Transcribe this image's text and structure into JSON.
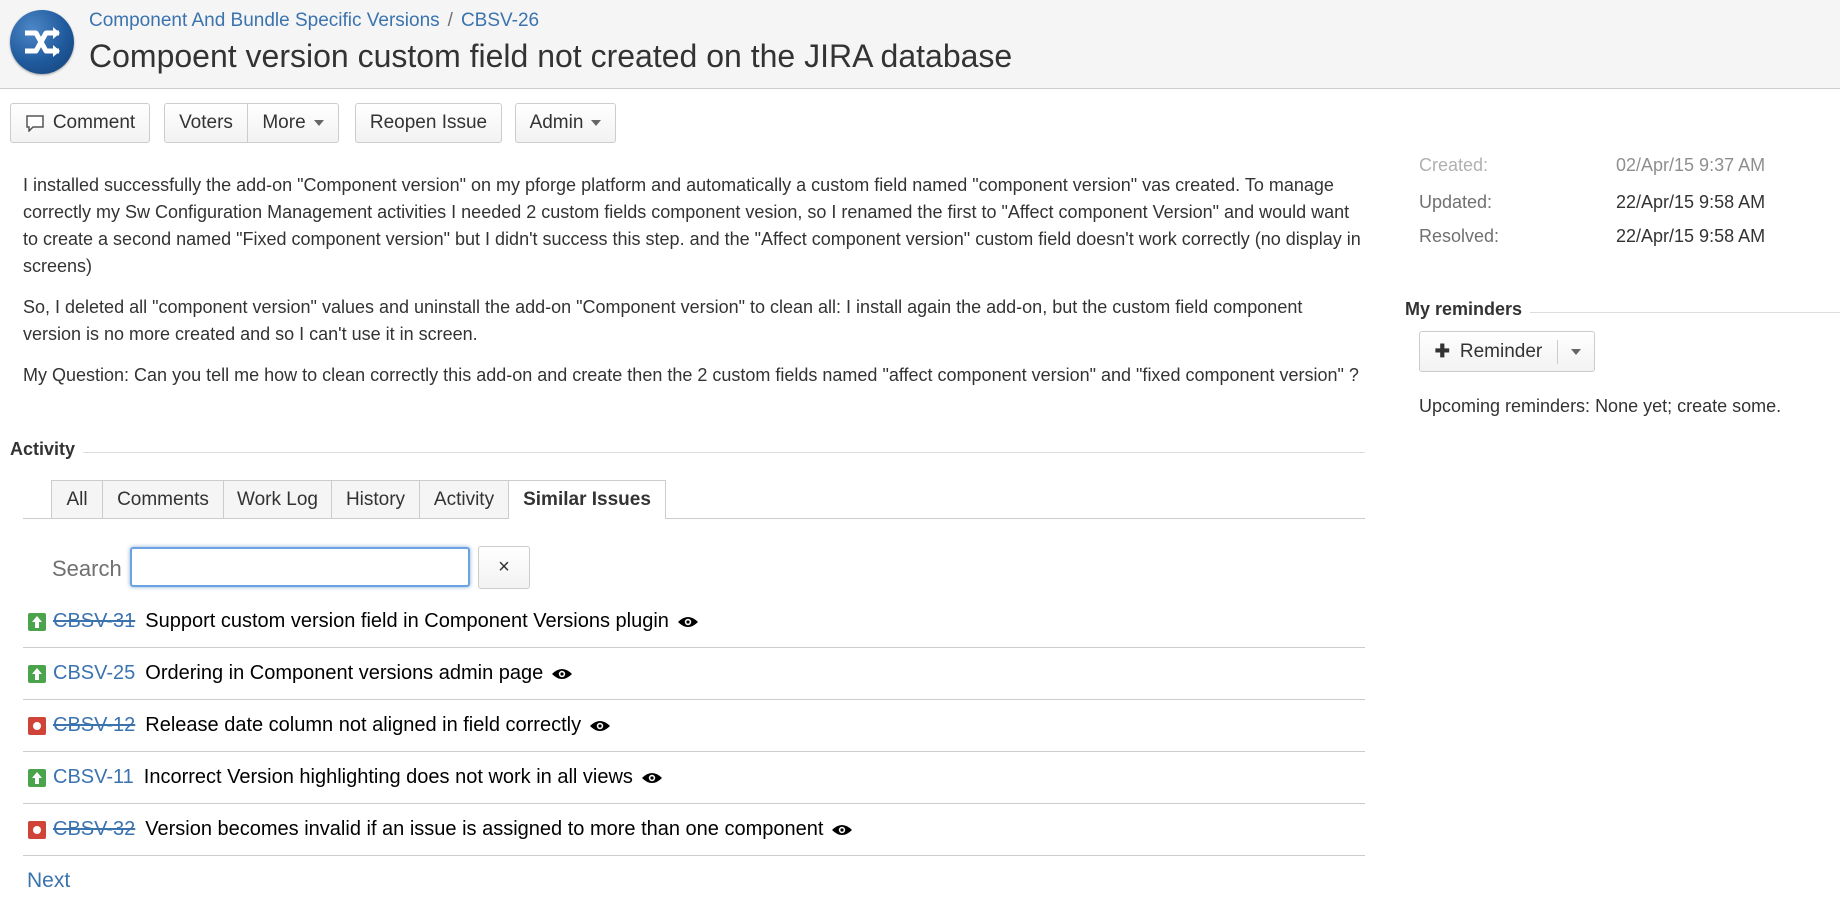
{
  "header": {
    "breadcrumb_project": "Component And Bundle Specific Versions",
    "breadcrumb_separator": "/",
    "breadcrumb_issue": "CBSV-26",
    "title": "Compoent version custom field not created on the JIRA database"
  },
  "toolbar": {
    "comment": "Comment",
    "voters": "Voters",
    "more": "More",
    "reopen": "Reopen Issue",
    "admin": "Admin"
  },
  "description": {
    "p1": "I installed successfully the add-on \"Component version\" on my pforge platform and automatically a custom field named \"component version\" vas created. To manage correctly my Sw Configuration Management activities I needed 2 custom fields component vesion, so I renamed the first to \"Affect component Version\" and would want to create a second named \"Fixed component version\" but I didn't success this step. and the \"Affect component version\" custom field doesn't work correctly (no display in screens)",
    "p2": "So, I deleted all \"component version\" values and uninstall the add-on \"Component version\" to clean all: I install again the add-on, but the custom field component version is no more created and so I can't use it in screen.",
    "p3": "My Question: Can you tell me how to clean correctly this add-on and create then the 2 custom fields named \"affect component version\" and \"fixed component version\" ?"
  },
  "activity": {
    "heading": "Activity",
    "tabs": [
      "All",
      "Comments",
      "Work Log",
      "History",
      "Activity",
      "Similar Issues"
    ],
    "active_tab": "Similar Issues",
    "search_label": "Search",
    "search_value": "",
    "clear_label": "×",
    "issues": [
      {
        "key": "CBSV-31",
        "summary": "Support custom version field in Component Versions plugin",
        "type": "improvement",
        "resolved": true
      },
      {
        "key": "CBSV-25",
        "summary": "Ordering in Component versions admin page",
        "type": "improvement",
        "resolved": false
      },
      {
        "key": "CBSV-12",
        "summary": "Release date column not aligned in field correctly",
        "type": "bug",
        "resolved": true
      },
      {
        "key": "CBSV-11",
        "summary": "Incorrect Version highlighting does not work in all views",
        "type": "improvement",
        "resolved": false
      },
      {
        "key": "CBSV-32",
        "summary": "Version becomes invalid if an issue is assigned to more than one component",
        "type": "bug",
        "resolved": true
      }
    ],
    "next": "Next"
  },
  "dates": {
    "created_label": "Created:",
    "created_value": "02/Apr/15 9:37 AM",
    "updated_label": "Updated:",
    "updated_value": "22/Apr/15 9:58 AM",
    "resolved_label": "Resolved:",
    "resolved_value": "22/Apr/15 9:58 AM"
  },
  "reminders": {
    "heading": "My reminders",
    "button": "Reminder",
    "upcoming": "Upcoming reminders: None yet; create some."
  },
  "colors": {
    "link": "#3b73af",
    "improvement": "#4ba34c",
    "bug": "#d04437",
    "focus": "#6aa2e3"
  },
  "icons": [
    "logo-icon",
    "comment-icon",
    "improvement-icon",
    "bug-icon",
    "watch-eye-icon",
    "plus-icon",
    "chevron-down-icon",
    "close-icon"
  ]
}
